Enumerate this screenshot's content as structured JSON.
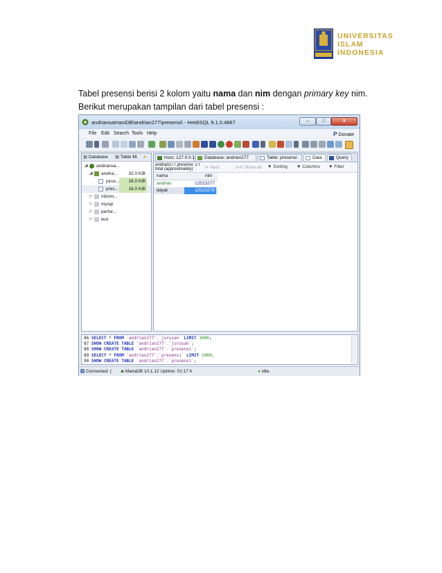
{
  "logo": {
    "line1": "UNIVERSITAS",
    "line2": "ISLAM",
    "line3": "INDONESIA"
  },
  "paragraph": {
    "p1": "Tabel presensi berisi 2 kolom yaitu ",
    "b1": "nama",
    "p2": " dan ",
    "b2": "nim",
    "p3": " dengan ",
    "i1": "primary key",
    "p4": " nim. Berikut merupakan tampilan dari tabel presensi :"
  },
  "window": {
    "title": "andriansatrianiDB\\andrian277\\presensi\\ - HeidiSQL 9.1.0.4867",
    "minimize": "–",
    "maximize": "□",
    "close": "x"
  },
  "menu": {
    "file": "File",
    "edit": "Edit",
    "search": "Search",
    "tools": "Tools",
    "help": "Help",
    "donate_p": "P",
    "donate": "Donate"
  },
  "left_tabs": {
    "database": "Database",
    "table_filter": "Table filt"
  },
  "tree": [
    {
      "label": "andriansa...",
      "size": ""
    },
    {
      "label": "andria...",
      "size": "32.0 KiB"
    },
    {
      "label": "jurus...",
      "size": "16.0 KiB"
    },
    {
      "label": "pres...",
      "size": "16.0 KiB"
    },
    {
      "label": "inform...",
      "size": ""
    },
    {
      "label": "mysql",
      "size": ""
    },
    {
      "label": "perfor...",
      "size": ""
    },
    {
      "label": "test",
      "size": ""
    }
  ],
  "right_tabs": {
    "host": "Host: 127.0.0.1",
    "database": "Database: andrian277",
    "table": "Table: presensi",
    "data": "Data",
    "query": "Query"
  },
  "data_toolbar": {
    "label1": "andrian277.presensi: 2 r",
    "label2": "total (approximately)",
    "next": "Next",
    "show_all": "Show all",
    "sorting": "Sorting",
    "columns": "Columns",
    "filter": "Filter"
  },
  "grid": {
    "headers": [
      "nama",
      "nim"
    ],
    "rows": [
      {
        "nama": "andrian",
        "nim": "12523277"
      },
      {
        "nama": "dayat",
        "nim": "12523278"
      }
    ]
  },
  "sql_log": [
    {
      "n": "86",
      "a": "SELECT",
      "b": " * ",
      "c": "FROM",
      "d": " `andrian277`.`jurusan` ",
      "e": "LIMIT",
      "f": " 1000",
      "g": ";"
    },
    {
      "n": "87",
      "a": "SHOW CREATE TABLE",
      "b": " ",
      "c": "",
      "d": "`andrian277`.`jurusan`",
      "e": "",
      "f": "",
      "g": ";"
    },
    {
      "n": "88",
      "a": "SHOW CREATE TABLE",
      "b": " ",
      "c": "",
      "d": "`andrian277`.`presensi`",
      "e": "",
      "f": "",
      "g": ";"
    },
    {
      "n": "89",
      "a": "SELECT",
      "b": " * ",
      "c": "FROM",
      "d": " `andrian277`.`presensi` ",
      "e": "LIMIT",
      "f": " 1000",
      "g": ";"
    },
    {
      "n": "90",
      "a": "SHOW CREATE TABLE",
      "b": " ",
      "c": "",
      "d": "`andrian277`.`presensi`",
      "e": "",
      "f": "",
      "g": ";"
    }
  ],
  "status": {
    "connected": "Connected: (",
    "server": "MariaDB 10.1.12",
    "uptime": "Uptime: 01:17 h",
    "idle": "Idle."
  }
}
